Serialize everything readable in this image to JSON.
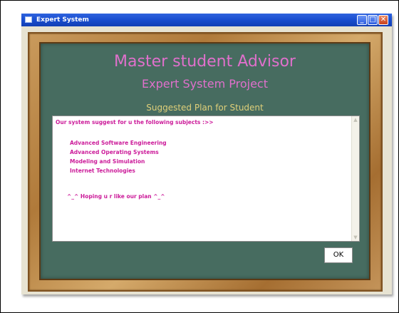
{
  "window": {
    "title": "Expert System",
    "buttons": {
      "minimize": "_",
      "maximize": "□",
      "close": "✕"
    }
  },
  "board": {
    "heading": "Master student Advisor",
    "subheading": "Expert System Project",
    "plan_title": "Suggested Plan for Student"
  },
  "result": {
    "intro": "Our system suggest for u the following subjects :>>",
    "subjects": [
      "Advanced Software Engineering",
      "Advanced Operating Systems",
      "Modeling and Simulation",
      "Internet Technologies"
    ],
    "closing": "^_^ Hoping u r like our plan ^_^"
  },
  "actions": {
    "ok_label": "OK"
  },
  "colors": {
    "titlebar": "#1a4fd1",
    "board": "#476c60",
    "heading": "#e070cc",
    "plan_title": "#dfcf79",
    "result_text": "#cc1c9a"
  }
}
